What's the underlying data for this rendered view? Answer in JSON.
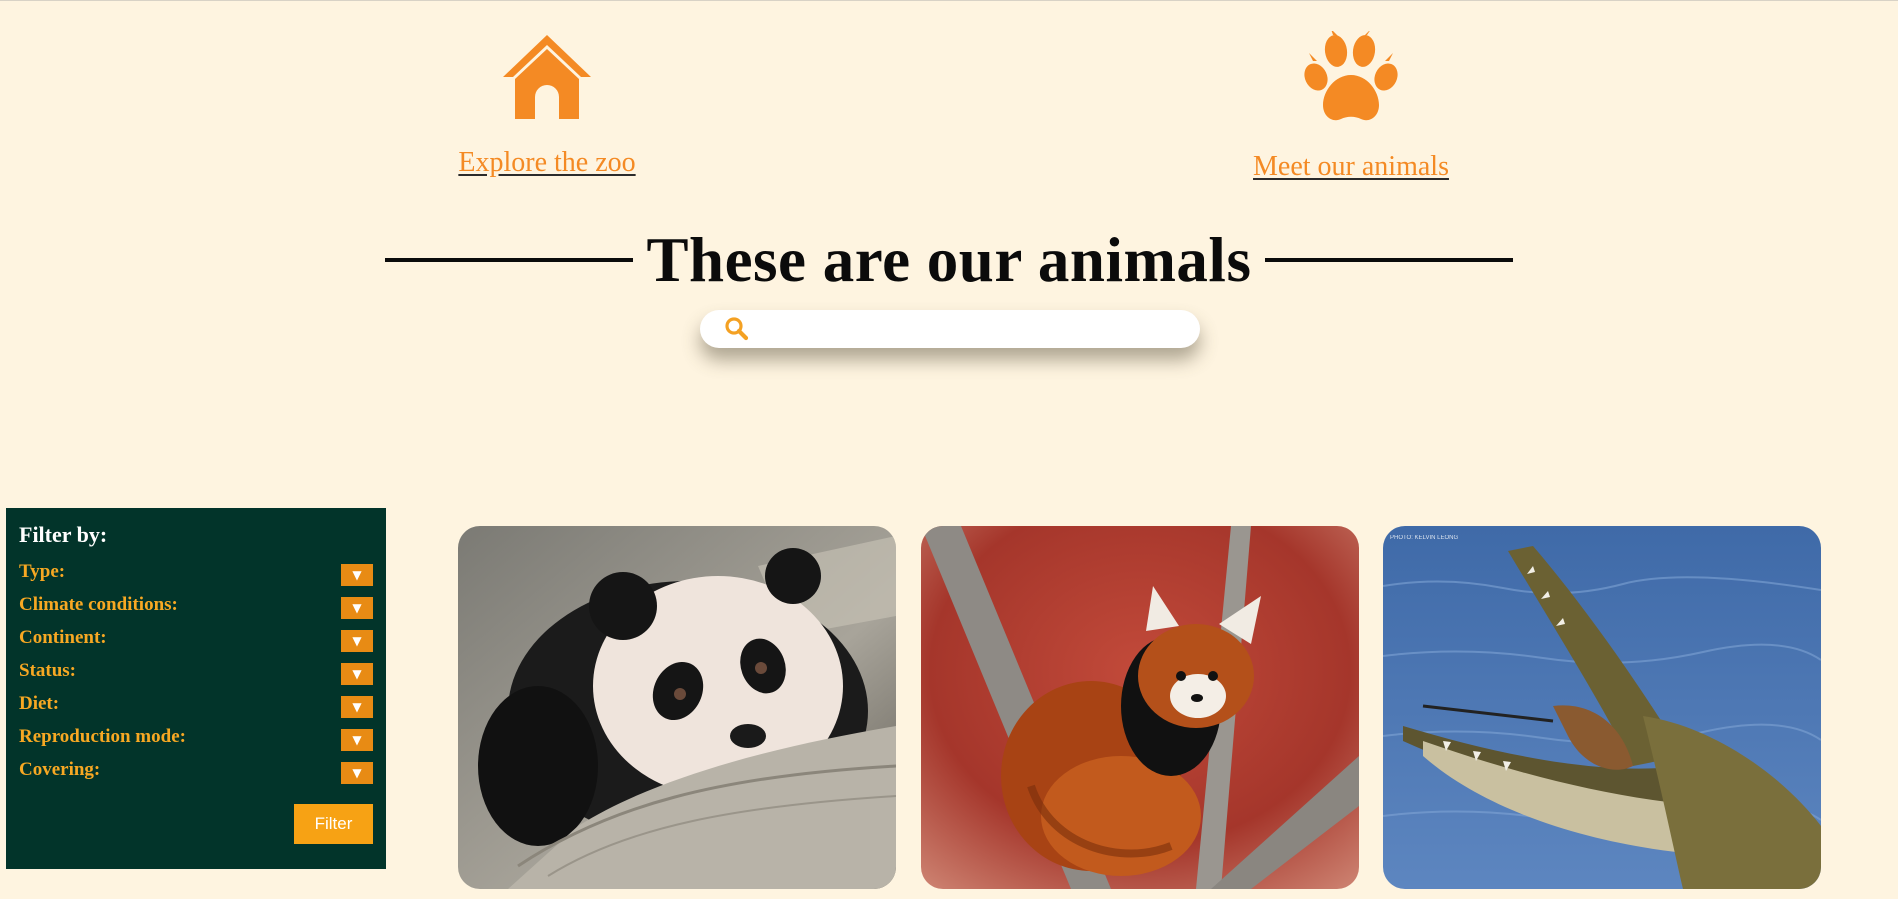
{
  "nav": {
    "home_label": "Explore the zoo",
    "animals_label": "Meet our animals",
    "home_icon": "house-icon",
    "animals_icon": "paw-print-icon"
  },
  "heading": "These are our animals",
  "search": {
    "placeholder": "",
    "icon": "search-icon"
  },
  "filter": {
    "title": "Filter by:",
    "fields": [
      {
        "label": "Type:"
      },
      {
        "label": "Climate conditions:"
      },
      {
        "label": "Continent:"
      },
      {
        "label": "Status:"
      },
      {
        "label": "Diet:"
      },
      {
        "label": "Reproduction mode:"
      },
      {
        "label": "Covering:"
      }
    ],
    "dropdown_glyph": "▼",
    "submit_label": "Filter"
  },
  "cards": [
    {
      "image": "panda-photo"
    },
    {
      "image": "red-panda-photo"
    },
    {
      "image": "crocodile-photo",
      "credit": "PHOTO: KELVIN LEONG"
    }
  ],
  "colors": {
    "background": "#fef4e0",
    "accent_orange": "#f48a24",
    "filter_panel": "#02342a",
    "filter_label": "#f7a823",
    "filter_button": "#f7a214"
  }
}
